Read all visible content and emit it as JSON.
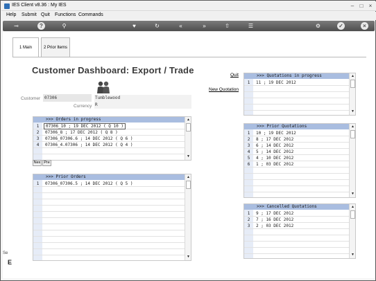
{
  "window": {
    "title": "IES Client v8.36 : My IES",
    "min_glyph": "–",
    "max_glyph": "□",
    "close_glyph": "×"
  },
  "menu": [
    "Help",
    "Submit",
    "Quit",
    "Functions",
    "Commands"
  ],
  "toolbar": {
    "icons": [
      "key-icon",
      "help-icon",
      "search-icon",
      "heart-icon",
      "refresh-icon",
      "rewind-icon",
      "fast-forward-icon",
      "export-icon",
      "list-icon",
      "settings-icon",
      "check-icon",
      "close-icon"
    ],
    "glyphs": [
      "⊸",
      "?",
      "⚲",
      "♥",
      "↻",
      "«",
      "»",
      "⇧",
      "☰",
      "⚙",
      "✓",
      "×"
    ]
  },
  "tabs": [
    {
      "label": "1 Main"
    },
    {
      "label": "2 Prior Items"
    }
  ],
  "page_title": "Customer Dashboard: Export / Trade",
  "customer": {
    "label": "Customer",
    "code": "07306",
    "name": "Tumblewood",
    "currency_label": "Currency",
    "currency": "R"
  },
  "links": {
    "quit": "Quit",
    "new_quotation": "New Quotation"
  },
  "buttons": {
    "next": "Nex",
    "prev": "Pre"
  },
  "orders_in_progress": {
    "header": ">>> Orders in progress",
    "rows": [
      "07306_10 ; 19 DEC 2012 ( Q 10 )",
      "07306_8 ; 17 DEC 2012 ( Q 8 )",
      "07306_07306.6 ; 14 DEC 2012 ( Q 6 )",
      "07306_4.07306 ; 14 DEC 2012 ( Q 4 )"
    ]
  },
  "prior_orders": {
    "header": ">>> Prior Orders",
    "rows": [
      "07306_07306.5 ; 14 DEC 2012 ( Q 5 )"
    ]
  },
  "quotations_in_progress": {
    "header": ">>> Quotations in progress",
    "rows": [
      "11 ; 19 DEC 2012"
    ]
  },
  "prior_quotations": {
    "header": ">>> Prior Quotations",
    "rows": [
      "10 ; 19 DEC 2012",
      "8 ; 17 DEC 2012",
      "6 ; 14 DEC 2012",
      "5 ; 14 DEC 2012",
      "4 ; 10 DEC 2012",
      "1 ; 03 DEC 2012"
    ]
  },
  "cancelled_quotations": {
    "header": ">>> Cancelled Quotations",
    "rows": [
      "9 ; 17 DEC 2012",
      "7 ; 16 DEC 2012",
      "2 ; 03 DEC 2012"
    ]
  },
  "left_edge": {
    "text1": "Se",
    "text2": "E"
  },
  "colors": {
    "grid_header": "#a9bde0",
    "toolbar": "#5a5a5a"
  }
}
